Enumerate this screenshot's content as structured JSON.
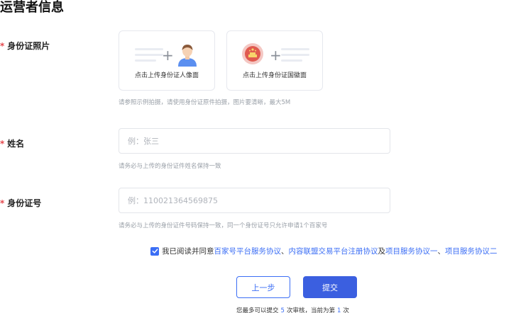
{
  "section": {
    "title": "运营者信息"
  },
  "id_photo": {
    "label": "身份证照片",
    "front_caption": "点击上传身份证人像面",
    "back_caption": "点击上传身份证国徽面",
    "hint": "请参照示例拍摄，请使用身份证原件拍摄，图片要清晰，最大5M"
  },
  "name": {
    "label": "姓名",
    "placeholder": "例：张三",
    "hint": "请务必与上传的身份证件姓名保持一致"
  },
  "id_number": {
    "label": "身份证号",
    "placeholder": "例：110021364569875",
    "hint": "请务必与上传的身份证件号码保持一致，同一个身份证号只允许申请1个百家号"
  },
  "agreement": {
    "prefix": "我已阅读并同意",
    "link1": "百家号平台服务协议",
    "sep1": "、",
    "link2": "内容联盟交易平台注册协议",
    "sep2": "及",
    "link3": "项目服务协议一",
    "sep3": "、",
    "link4": "项目服务协议二"
  },
  "buttons": {
    "prev": "上一步",
    "submit": "提交"
  },
  "quota": {
    "prefix": "您最多可以提交",
    "max": "5",
    "middle": "次审核，当前为第",
    "current": "1",
    "suffix": "次"
  },
  "colors": {
    "accent": "#3b6ef5",
    "required": "#e5484d"
  }
}
